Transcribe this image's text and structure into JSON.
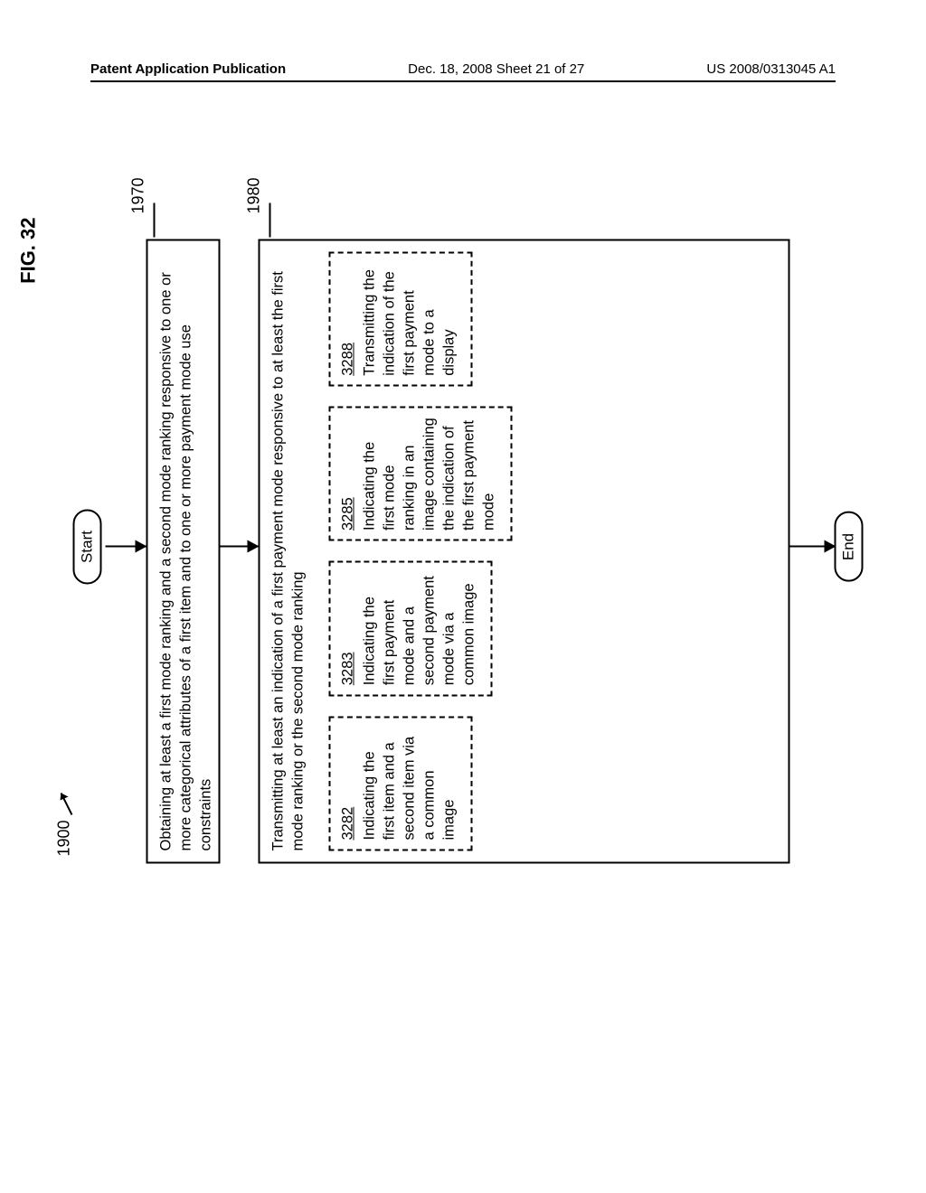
{
  "header": {
    "left": "Patent Application Publication",
    "center": "Dec. 18, 2008  Sheet 21 of 27",
    "right": "US 2008/0313045 A1"
  },
  "figure": {
    "label": "FIG. 32",
    "flow_number": "1900",
    "start": "Start",
    "end": "End",
    "ref_1970": "1970",
    "ref_1980": "1980",
    "box_1970": "Obtaining at least a first mode ranking and a second mode ranking responsive to one or more categorical attributes of a first item and to one or more payment mode use constraints",
    "box_1980_intro": "Transmitting at least an indication of a first payment mode responsive to at least the first mode ranking or the second mode ranking",
    "sub": {
      "b3282": {
        "num": "3282",
        "text": "Indicating the first item and a second item via a common image"
      },
      "b3283": {
        "num": "3283",
        "text": "Indicating the first payment mode and a second payment mode via a common image"
      },
      "b3285": {
        "num": "3285",
        "text": "Indicating the first mode ranking in an image containing the indication of the first payment mode"
      },
      "b3288": {
        "num": "3288",
        "text": "Transmitting the indication of the first payment mode to a display"
      }
    }
  }
}
